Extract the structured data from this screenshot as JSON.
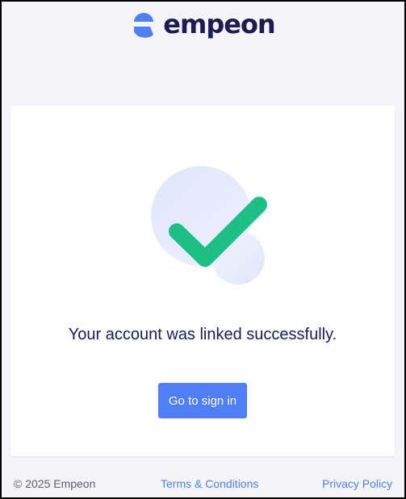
{
  "brand": {
    "name": "empeon",
    "primary_color": "#4f7ff7",
    "text_color": "#1c1b53"
  },
  "confirmation": {
    "icon": "checkmark-icon",
    "check_color": "#1cbf86",
    "message": "Your account was linked successfully.",
    "button_label": "Go to sign in"
  },
  "footer": {
    "copyright": "© 2025 Empeon",
    "terms_label": "Terms & Conditions",
    "privacy_label": "Privacy Policy"
  }
}
